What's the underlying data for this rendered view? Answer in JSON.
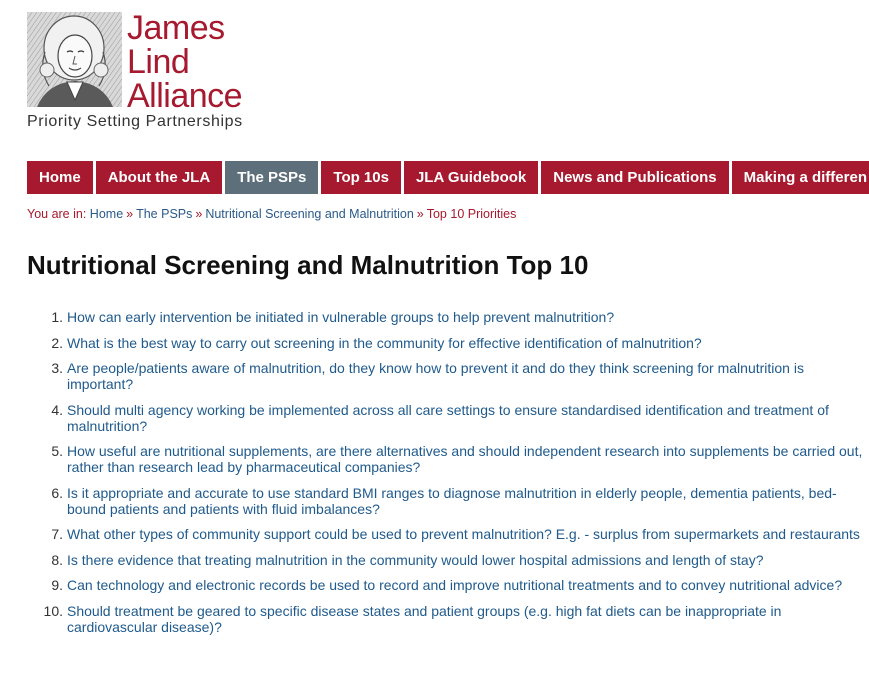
{
  "logo": {
    "name_lines": [
      "James",
      "Lind",
      "Alliance"
    ],
    "subtitle": "Priority Setting Partnerships"
  },
  "nav": {
    "items": [
      {
        "label": "Home",
        "active": false
      },
      {
        "label": "About the JLA",
        "active": false
      },
      {
        "label": "The PSPs",
        "active": true
      },
      {
        "label": "Top 10s",
        "active": false
      },
      {
        "label": "JLA Guidebook",
        "active": false
      },
      {
        "label": "News and Publications",
        "active": false
      },
      {
        "label": "Making a differen",
        "active": false
      }
    ]
  },
  "breadcrumb": {
    "prefix": "You are in:",
    "links": [
      "Home",
      "The PSPs",
      "Nutritional Screening and Malnutrition"
    ],
    "current": "Top 10 Priorities",
    "separator": "»"
  },
  "page": {
    "title": "Nutritional Screening and Malnutrition Top 10"
  },
  "priorities": [
    {
      "num": "1.",
      "text": "How can early intervention be initiated in vulnerable groups to help prevent malnutrition?"
    },
    {
      "num": "2.",
      "text": "What is the best way to carry out screening in the community for effective identification of malnutrition?"
    },
    {
      "num": "3.",
      "text": "Are people/patients aware of malnutrition, do they know how to prevent it and do they think screening for malnutrition is important?"
    },
    {
      "num": "4.",
      "text": "Should multi agency working be implemented across all care settings to ensure standardised identification and treatment of malnutrition?"
    },
    {
      "num": "5.",
      "text": "How useful are nutritional supplements, are there alternatives and should independent research into supplements be carried out, rather than research lead by pharmaceutical companies?"
    },
    {
      "num": "6.",
      "text": "Is it appropriate and accurate to use standard BMI ranges to diagnose malnutrition in elderly people, dementia patients, bed-bound patients and patients with fluid imbalances?"
    },
    {
      "num": "7.",
      "text": "What other types of community support could be used to prevent malnutrition? E.g. - surplus from supermarkets and restaurants"
    },
    {
      "num": "8.",
      "text": "Is there evidence that treating malnutrition in the community would lower hospital admissions and length of stay?"
    },
    {
      "num": "9.",
      "text": "Can technology and electronic records be used to record and improve nutritional treatments and to convey nutritional advice?"
    },
    {
      "num": "10.",
      "text": "Should treatment be geared to specific disease states and patient groups (e.g. high fat diets can be inappropriate in cardiovascular disease)?"
    }
  ],
  "colors": {
    "brand": "#a6192e",
    "nav_active": "#5e6f7c",
    "link": "#1f5a8c"
  }
}
